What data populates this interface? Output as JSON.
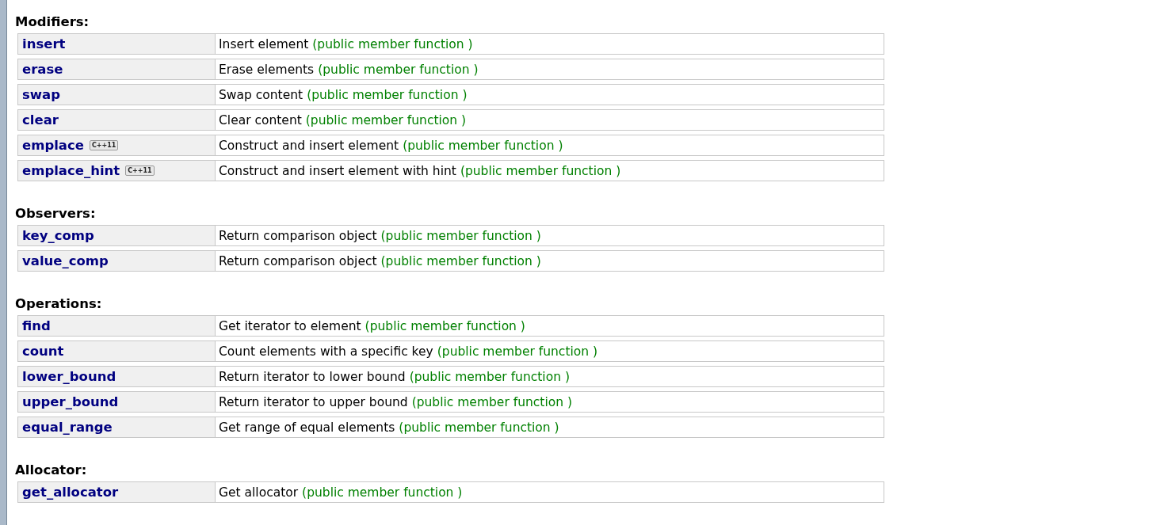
{
  "sections": [
    {
      "title": "Modifiers:",
      "rows": [
        {
          "name": "insert",
          "description": "Insert element",
          "kind_label": "(public member function )"
        },
        {
          "name": "erase",
          "description": "Erase elements",
          "kind_label": "(public member function )"
        },
        {
          "name": "swap",
          "description": "Swap content",
          "kind_label": "(public member function )"
        },
        {
          "name": "clear",
          "description": "Clear content",
          "kind_label": "(public member function )"
        },
        {
          "name": "emplace",
          "badge": "C++11",
          "description": "Construct and insert element",
          "kind_label": "(public member function )"
        },
        {
          "name": "emplace_hint",
          "badge": "C++11",
          "description": "Construct and insert element with hint",
          "kind_label": "(public member function )"
        }
      ]
    },
    {
      "title": "Observers:",
      "rows": [
        {
          "name": "key_comp",
          "description": "Return comparison object",
          "kind_label": "(public member function )"
        },
        {
          "name": "value_comp",
          "description": "Return comparison object",
          "kind_label": "(public member function )"
        }
      ]
    },
    {
      "title": "Operations:",
      "rows": [
        {
          "name": "find",
          "description": "Get iterator to element",
          "kind_label": "(public member function )"
        },
        {
          "name": "count",
          "description": "Count elements with a specific key",
          "kind_label": "(public member function )"
        },
        {
          "name": "lower_bound",
          "description": "Return iterator to lower bound",
          "kind_label": "(public member function )"
        },
        {
          "name": "upper_bound",
          "description": "Return iterator to upper bound",
          "kind_label": "(public member function )"
        },
        {
          "name": "equal_range",
          "description": "Get range of equal elements",
          "kind_label": "(public member function )"
        }
      ]
    },
    {
      "title": "Allocator:",
      "rows": [
        {
          "name": "get_allocator",
          "description": "Get allocator",
          "kind_label": "(public member function )"
        }
      ]
    }
  ]
}
